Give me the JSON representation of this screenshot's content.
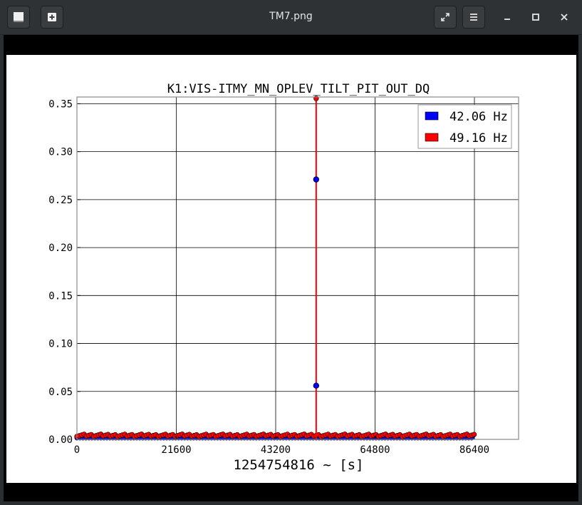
{
  "window": {
    "title": "TM7.png",
    "icons": {
      "left1": "window-icon",
      "left2": "new-tab-icon",
      "right1": "fullscreen-icon",
      "right2": "menu-icon"
    }
  },
  "chart_data": {
    "type": "scatter",
    "title": "K1:VIS-ITMY_MN_OPLEV_TILT_PIT_OUT_DQ",
    "xlabel": "1254754816 ~ [s]",
    "ylabel": "",
    "xlim": [
      0,
      96000
    ],
    "ylim": [
      0,
      0.357
    ],
    "xticks": [
      0,
      21600,
      43200,
      64800,
      86400
    ],
    "yticks": [
      0.0,
      0.05,
      0.1,
      0.15,
      0.2,
      0.25,
      0.3,
      0.35
    ],
    "ytick_labels": [
      "0.00",
      "0.05",
      "0.10",
      "0.15",
      "0.20",
      "0.25",
      "0.30",
      "0.35"
    ],
    "grid": true,
    "legend": "top-right",
    "series": [
      {
        "name": "42.06 Hz",
        "color": "#0000ff",
        "baseline_y": 0.0015,
        "points": [
          [
            52000,
            0.271
          ],
          [
            52000,
            0.056
          ]
        ]
      },
      {
        "name": "49.16 Hz",
        "color": "#ff0000",
        "baseline_y": 0.003,
        "spike": {
          "x": 52000,
          "y_from": 0.0,
          "y_to": 0.357
        }
      }
    ]
  }
}
